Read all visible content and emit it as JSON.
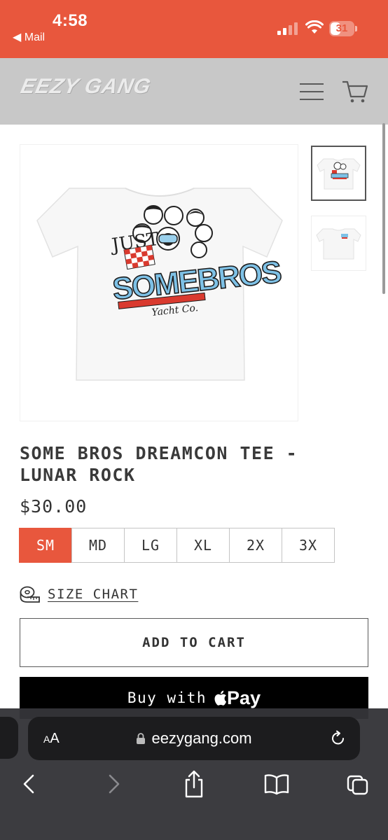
{
  "status_bar": {
    "time": "4:58",
    "back_label": "◀ Mail",
    "battery": "31",
    "accent": "#e8573d"
  },
  "site": {
    "logo_text": "EEZY GANG",
    "menu_icon": "hamburger-menu-icon",
    "cart_icon": "cart-icon"
  },
  "product": {
    "title": "SOME BROS DREAMCON TEE - LUNAR ROCK",
    "price": "$30.00",
    "sizes": [
      "SM",
      "MD",
      "LG",
      "XL",
      "2X",
      "3X"
    ],
    "selected_size": "SM",
    "size_chart_label": "SIZE CHART",
    "add_to_cart_label": "ADD TO CART",
    "buy_with_label": "Buy with",
    "pay_label": "Pay",
    "image_text_top": "JUST",
    "image_text_main": "SOMEBROS",
    "image_text_sub": "Yacht Co."
  },
  "browser": {
    "text_size_label_small": "A",
    "text_size_label_large": "A",
    "url": "eezygang.com"
  }
}
